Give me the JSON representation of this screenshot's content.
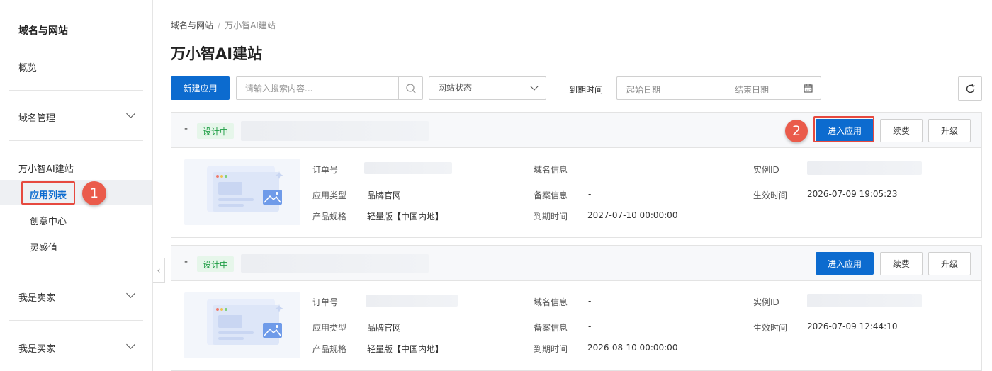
{
  "sidebar": {
    "title": "域名与网站",
    "overview": "概览",
    "domain_mgmt": "域名管理",
    "ai_site": "万小智AI建站",
    "sub_items": [
      "应用列表",
      "创意中心",
      "灵感值"
    ],
    "seller": "我是卖家",
    "buyer": "我是买家"
  },
  "badges": [
    "1",
    "2"
  ],
  "breadcrumb": {
    "root": "域名与网站",
    "sep": "/",
    "current": "万小智AI建站"
  },
  "page_title": "万小智AI建站",
  "toolbar": {
    "new_app": "新建应用",
    "search_placeholder": "请输入搜索内容...",
    "status_select": "网站状态",
    "expire_label": "到期时间",
    "start_date": "起始日期",
    "range_sep": "-",
    "end_date": "结束日期"
  },
  "cards": [
    {
      "dash": "-",
      "status": "设计中",
      "enter": "进入应用",
      "renew": "续费",
      "upgrade": "升级",
      "labels": {
        "order": "订单号",
        "app_type": "应用类型",
        "spec": "产品规格",
        "domain": "域名信息",
        "icp": "备案信息",
        "expire": "到期时间",
        "instance": "实例ID",
        "effective": "生效时间"
      },
      "values": {
        "app_type": "品牌官网",
        "spec": "轻量版【中国内地】",
        "domain": "-",
        "icp": "-",
        "expire": "2027-07-10 00:00:00",
        "effective": "2026-07-09 19:05:23"
      }
    },
    {
      "dash": "-",
      "status": "设计中",
      "enter": "进入应用",
      "renew": "续费",
      "upgrade": "升级",
      "labels": {
        "order": "订单号",
        "app_type": "应用类型",
        "spec": "产品规格",
        "domain": "域名信息",
        "icp": "备案信息",
        "expire": "到期时间",
        "instance": "实例ID",
        "effective": "生效时间"
      },
      "values": {
        "app_type": "品牌官网",
        "spec": "轻量版【中国内地】",
        "domain": "-",
        "icp": "-",
        "expire": "2026-08-10 00:00:00",
        "effective": "2026-07-09 12:44:10"
      }
    }
  ],
  "colors": {
    "primary": "#0c6bcf",
    "annotation": "#e6493f",
    "status_green": "#1f9e45"
  }
}
